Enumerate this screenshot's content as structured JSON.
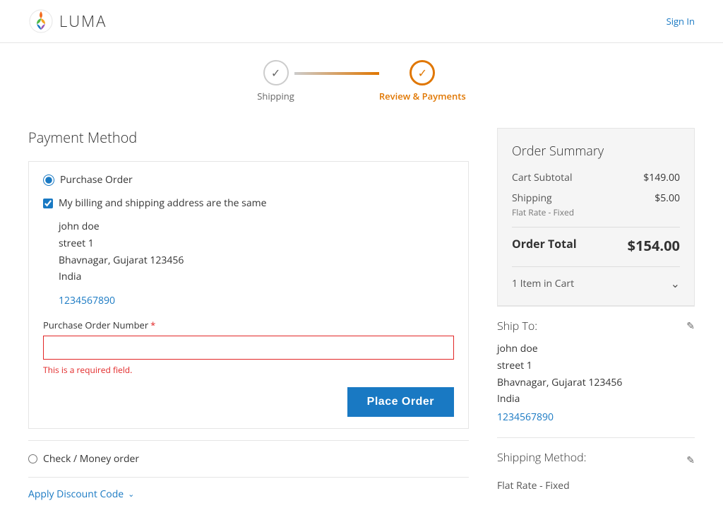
{
  "header": {
    "logo_text": "LUMA",
    "sign_in_label": "Sign In"
  },
  "progress": {
    "step1_label": "Shipping",
    "step2_label": "Review & Payments"
  },
  "payment": {
    "section_title": "Payment Method",
    "purchase_order_label": "Purchase Order",
    "billing_checkbox_label": "My billing and shipping address are the same",
    "address_name": "john doe",
    "address_street": "street 1",
    "address_city_state_zip": "Bhavnagar, Gujarat 123456",
    "address_country": "India",
    "address_phone": "1234567890",
    "po_number_label": "Purchase Order Number",
    "po_number_required_mark": "*",
    "required_field_msg": "This is a required field.",
    "place_order_label": "Place Order",
    "check_money_label": "Check / Money order",
    "apply_discount_label": "Apply Discount Code"
  },
  "order_summary": {
    "title": "Order Summary",
    "cart_subtotal_label": "Cart Subtotal",
    "cart_subtotal_value": "$149.00",
    "shipping_label": "Shipping",
    "shipping_sub_label": "Flat Rate - Fixed",
    "shipping_value": "$5.00",
    "order_total_label": "Order Total",
    "order_total_value": "$154.00",
    "item_cart_label": "1 Item in Cart"
  },
  "ship_to": {
    "title": "Ship To:",
    "name": "john doe",
    "street": "street 1",
    "city_state_zip": "Bhavnagar, Gujarat 123456",
    "country": "India",
    "phone": "1234567890"
  },
  "shipping_method": {
    "title": "Shipping Method:",
    "value": "Flat Rate - Fixed"
  }
}
